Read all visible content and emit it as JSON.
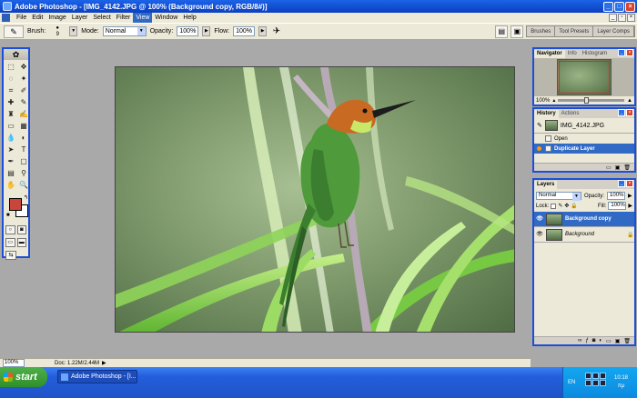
{
  "window": {
    "title": "Adobe Photoshop - [IMG_4142.JPG @ 100% (Background copy, RGB/8#)]",
    "controls": [
      "_",
      "□",
      "×"
    ]
  },
  "menu": {
    "items": [
      "File",
      "Edit",
      "Image",
      "Layer",
      "Select",
      "Filter",
      "View",
      "Window",
      "Help"
    ],
    "active": "View"
  },
  "options": {
    "brush_label": "Brush:",
    "brush_size": "9",
    "mode_label": "Mode:",
    "mode_value": "Normal",
    "opacity_label": "Opacity:",
    "opacity_value": "100%",
    "flow_label": "Flow:",
    "flow_value": "100%",
    "palette_well_tabs": [
      "Brushes",
      "Tool Presets",
      "Layer Comps"
    ]
  },
  "toolbox": {
    "foreground_color": "#c9473a",
    "background_color": "#ffffff"
  },
  "status": {
    "zoom": "100%",
    "doc_size": "Doc: 1.22M/2.44M"
  },
  "navigator": {
    "tabs": [
      "Navigator",
      "Info",
      "Histogram"
    ],
    "zoom": "100%"
  },
  "history": {
    "tabs": [
      "History",
      "Actions"
    ],
    "snapshot": "IMG_4142.JPG",
    "items": [
      "Open",
      "Duplicate Layer"
    ],
    "selected": "Duplicate Layer"
  },
  "layers": {
    "tabs": [
      "Layers"
    ],
    "blend_mode": "Normal",
    "opacity_label": "Opacity:",
    "opacity_value": "100%",
    "lock_label": "Lock:",
    "fill_label": "Fill:",
    "fill_value": "100%",
    "items": [
      {
        "name": "Background copy",
        "selected": true
      },
      {
        "name": "Background",
        "selected": false,
        "locked": true
      }
    ]
  },
  "taskbar": {
    "start_label": "start",
    "task_label": "Adobe Photoshop - [I...",
    "language": "EN",
    "time": "10:18",
    "time_suffix": "πμ"
  },
  "accent_colors": {
    "xp_blue": "#245edb",
    "selection": "#316ac5",
    "panel_bg": "#ece9d8"
  }
}
